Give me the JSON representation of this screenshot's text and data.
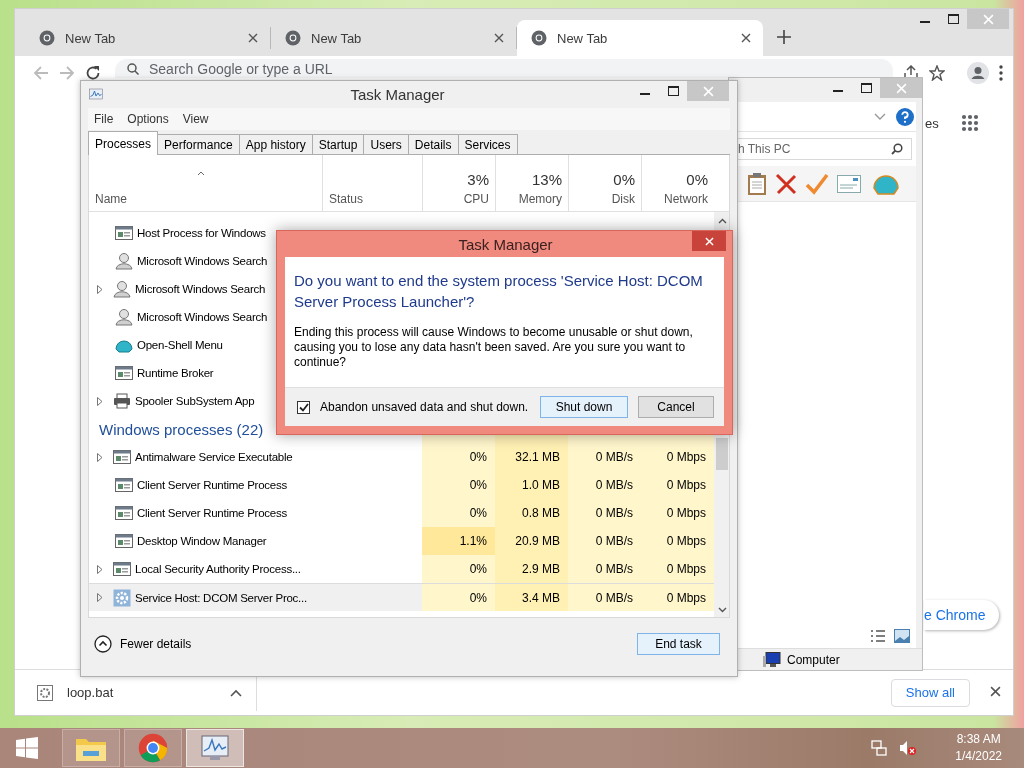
{
  "browser": {
    "tabs": [
      {
        "title": "New Tab",
        "selected": false
      },
      {
        "title": "New Tab",
        "selected": false
      },
      {
        "title": "New Tab",
        "selected": true
      }
    ],
    "omnibox": {
      "placeholder": "Search Google or type a URL"
    },
    "page": {
      "link": "es",
      "chrome_button": "e Chrome"
    },
    "downloads": {
      "file": "loop.bat",
      "show_all": "Show all"
    }
  },
  "explorer": {
    "search_placeholder": "h This PC",
    "status": "Computer"
  },
  "task_manager": {
    "title": "Task Manager",
    "menu": [
      "File",
      "Options",
      "View"
    ],
    "tabs": [
      {
        "label": "Processes",
        "selected": true
      },
      {
        "label": "Performance",
        "selected": false
      },
      {
        "label": "App history",
        "selected": false
      },
      {
        "label": "Startup",
        "selected": false
      },
      {
        "label": "Users",
        "selected": false
      },
      {
        "label": "Details",
        "selected": false
      },
      {
        "label": "Services",
        "selected": false
      }
    ],
    "columns": [
      {
        "label": "Name"
      },
      {
        "label": "Status"
      },
      {
        "label": "CPU",
        "percent": "3%"
      },
      {
        "label": "Memory",
        "percent": "13%"
      },
      {
        "label": "Disk",
        "percent": "0%"
      },
      {
        "label": "Network",
        "percent": "0%"
      }
    ],
    "rows": [
      {
        "kind": "process",
        "name": "Host Process for Windows",
        "expandable": false,
        "selected": false
      },
      {
        "kind": "process",
        "name": "Microsoft Windows Search",
        "expandable": false,
        "selected": false
      },
      {
        "kind": "process",
        "name": "Microsoft Windows Search",
        "expandable": true,
        "selected": false
      },
      {
        "kind": "process",
        "name": "Microsoft Windows Search",
        "expandable": false,
        "selected": false
      },
      {
        "kind": "process",
        "name": "Open-Shell Menu",
        "expandable": false,
        "selected": false
      },
      {
        "kind": "process",
        "name": "Runtime Broker",
        "expandable": false,
        "selected": false
      },
      {
        "kind": "process",
        "name": "Spooler SubSystem App",
        "expandable": true,
        "selected": false
      },
      {
        "kind": "group",
        "name": "Windows processes (22)"
      },
      {
        "kind": "process",
        "name": "Antimalware Service Executable",
        "expandable": true,
        "selected": false,
        "cpu": "0%",
        "memory": "32.1 MB",
        "disk": "0 MB/s",
        "network": "0 Mbps"
      },
      {
        "kind": "process",
        "name": "Client Server Runtime Process",
        "expandable": false,
        "selected": false,
        "cpu": "0%",
        "memory": "1.0 MB",
        "disk": "0 MB/s",
        "network": "0 Mbps"
      },
      {
        "kind": "process",
        "name": "Client Server Runtime Process",
        "expandable": false,
        "selected": false,
        "cpu": "0%",
        "memory": "0.8 MB",
        "disk": "0 MB/s",
        "network": "0 Mbps"
      },
      {
        "kind": "process",
        "name": "Desktop Window Manager",
        "expandable": false,
        "selected": false,
        "cpu": "1.1%",
        "memory": "20.9 MB",
        "disk": "0 MB/s",
        "network": "0 Mbps"
      },
      {
        "kind": "process",
        "name": "Local Security Authority Process...",
        "expandable": true,
        "selected": false,
        "cpu": "0%",
        "memory": "2.9 MB",
        "disk": "0 MB/s",
        "network": "0 Mbps"
      },
      {
        "kind": "process",
        "name": "Service Host: DCOM Server Proc...",
        "expandable": true,
        "selected": true,
        "cpu": "0%",
        "memory": "3.4 MB",
        "disk": "0 MB/s",
        "network": "0 Mbps"
      }
    ],
    "fewer_details": "Fewer details",
    "end_task": "End task"
  },
  "dialog": {
    "title": "Task Manager",
    "question": "Do you want to end the system process 'Service Host: DCOM Server Process Launcher'?",
    "body": "Ending this process will cause Windows to become unusable or shut down, causing you to lose any data hasn't been saved. Are you sure you want to continue?",
    "checkbox": {
      "label": "Abandon unsaved data and shut down.",
      "checked": true
    },
    "buttons": [
      {
        "label": "Shut down",
        "default": true
      },
      {
        "label": "Cancel",
        "default": false
      }
    ]
  },
  "taskbar": {
    "apps": [
      {
        "kind": "explorer",
        "active": false
      },
      {
        "kind": "chrome",
        "active": false
      },
      {
        "kind": "taskmgr",
        "active": true
      }
    ],
    "time": "8:38 AM",
    "date": "1/4/2022"
  }
}
